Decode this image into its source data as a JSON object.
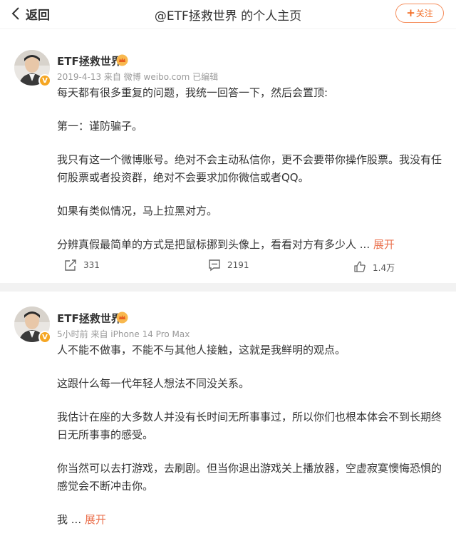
{
  "header": {
    "back_label": "返回",
    "title": "@ETF拯救世界 的个人主页",
    "follow_label": "关注",
    "follow_plus": "+"
  },
  "colors": {
    "accent": "#eb7350",
    "follow": "#f26a21",
    "badge": "#f5a623",
    "separator": "#f2f2f2"
  },
  "posts": [
    {
      "username": "ETF拯救世界",
      "meta": "2019-4-13  来自 微博 weibo.com  已编辑",
      "paragraphs": [
        "每天都有很多重复的问题，我统一回答一下，然后会置顶:",
        "第一：谨防骗子。",
        "我只有这一个微博账号。绝对不会主动私信你，更不会要带你操作股票。我没有任何股票或者投资群，绝对不会要求加你微信或者QQ。",
        "如果有类似情况，马上拉黑对方。",
        "分辨真假最简单的方式是把鼠标挪到头像上，看看对方有多少人"
      ],
      "ellipsis": " ... ",
      "expand_label": "展开",
      "repost_count": "331",
      "comment_count": "2191",
      "like_count": "1.4万"
    },
    {
      "username": "ETF拯救世界",
      "meta": "5小时前  来自 iPhone 14 Pro Max",
      "paragraphs": [
        "人不能不做事，不能不与其他人接触，这就是我鲜明的观点。",
        "这跟什么每一代年轻人想法不同没关系。",
        "我估计在座的大多数人并没有长时间无所事事过，所以你们也根本体会不到长期终日无所事事的感受。",
        "你当然可以去打游戏，去刷剧。但当你退出游戏关上播放器，空虚寂寞懊悔恐惧的感觉会不断冲击你。",
        "我"
      ],
      "ellipsis": " ... ",
      "expand_label": "展开"
    }
  ],
  "icons": {
    "back": "chevron-left-icon",
    "repost": "repost-icon",
    "comment": "comment-icon",
    "like": "thumbs-up-icon",
    "verified": "verified-v-icon",
    "member": "member-crown-icon"
  },
  "verified_mark": "V"
}
